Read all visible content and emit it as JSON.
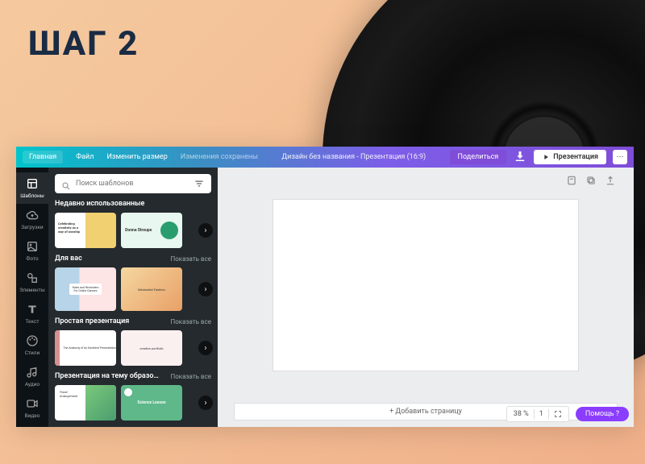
{
  "overlay": {
    "step_title": "ШАГ 2"
  },
  "topbar": {
    "home": "Главная",
    "file": "Файл",
    "resize": "Изменить размер",
    "saved": "Изменения сохранены",
    "doc_title": "Дизайн без названия - Презентация (16:9)",
    "share": "Поделиться",
    "present": "Презентация"
  },
  "rail": {
    "items": [
      {
        "id": "templates",
        "label": "Шаблоны"
      },
      {
        "id": "uploads",
        "label": "Загрузки"
      },
      {
        "id": "photo",
        "label": "Фото"
      },
      {
        "id": "elements",
        "label": "Элементы"
      },
      {
        "id": "text",
        "label": "Текст"
      },
      {
        "id": "styles",
        "label": "Стили"
      },
      {
        "id": "audio",
        "label": "Аудио"
      },
      {
        "id": "video",
        "label": "Видео"
      }
    ]
  },
  "panel": {
    "search_placeholder": "Поиск шаблонов",
    "sections": [
      {
        "title": "Недавно использованные",
        "show_all": "",
        "items": [
          "Celebrating creativity as a way of worship",
          "Donna Stroupe"
        ]
      },
      {
        "title": "Для вас",
        "show_all": "Показать все",
        "items": [
          "Rules and Reminders For Online Classes",
          "Minimalist Fashion"
        ]
      },
      {
        "title": "Простая презентация",
        "show_all": "Показать все",
        "items": [
          "The Anatomy of an Excellent Presentation",
          "creative portfolio"
        ]
      },
      {
        "title": "Презентация на тему образо…",
        "show_all": "Показать все",
        "items": [
          "Floral Arrangement",
          "Science Lesson"
        ]
      }
    ]
  },
  "canvas": {
    "add_page": "+ Добавить страницу"
  },
  "bottombar": {
    "zoom": "38 %",
    "pages": "1",
    "help": "Помощь ?"
  }
}
